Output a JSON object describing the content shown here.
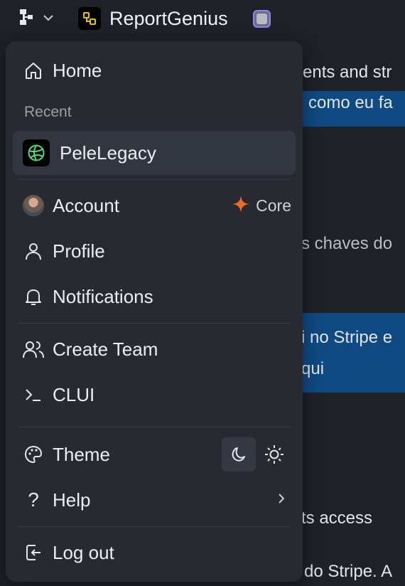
{
  "topbar": {
    "app_title": "ReportGenius",
    "workspace_icon": "workspace-switcher-icon",
    "chevron_icon": "chevron-down-icon"
  },
  "background": {
    "line1": "ents and str",
    "line2": "como eu fa",
    "line3": "s chaves do",
    "line4": "i no Stripe e",
    "line5": "qui",
    "line6": "ts access",
    "line7": "do Stripe. A"
  },
  "menu": {
    "home": "Home",
    "recent_label": "Recent",
    "recent_item": "PeleLegacy",
    "account": "Account",
    "plan": "Core",
    "profile": "Profile",
    "notifications": "Notifications",
    "create_team": "Create Team",
    "clui": "CLUI",
    "theme": "Theme",
    "help": "Help",
    "logout": "Log out"
  },
  "colors": {
    "background": "#1e2127",
    "menu": "#272a31",
    "highlight": "#0f4a82",
    "accent_orange": "#f26a2b",
    "recent_logo_green": "#4ade80"
  }
}
